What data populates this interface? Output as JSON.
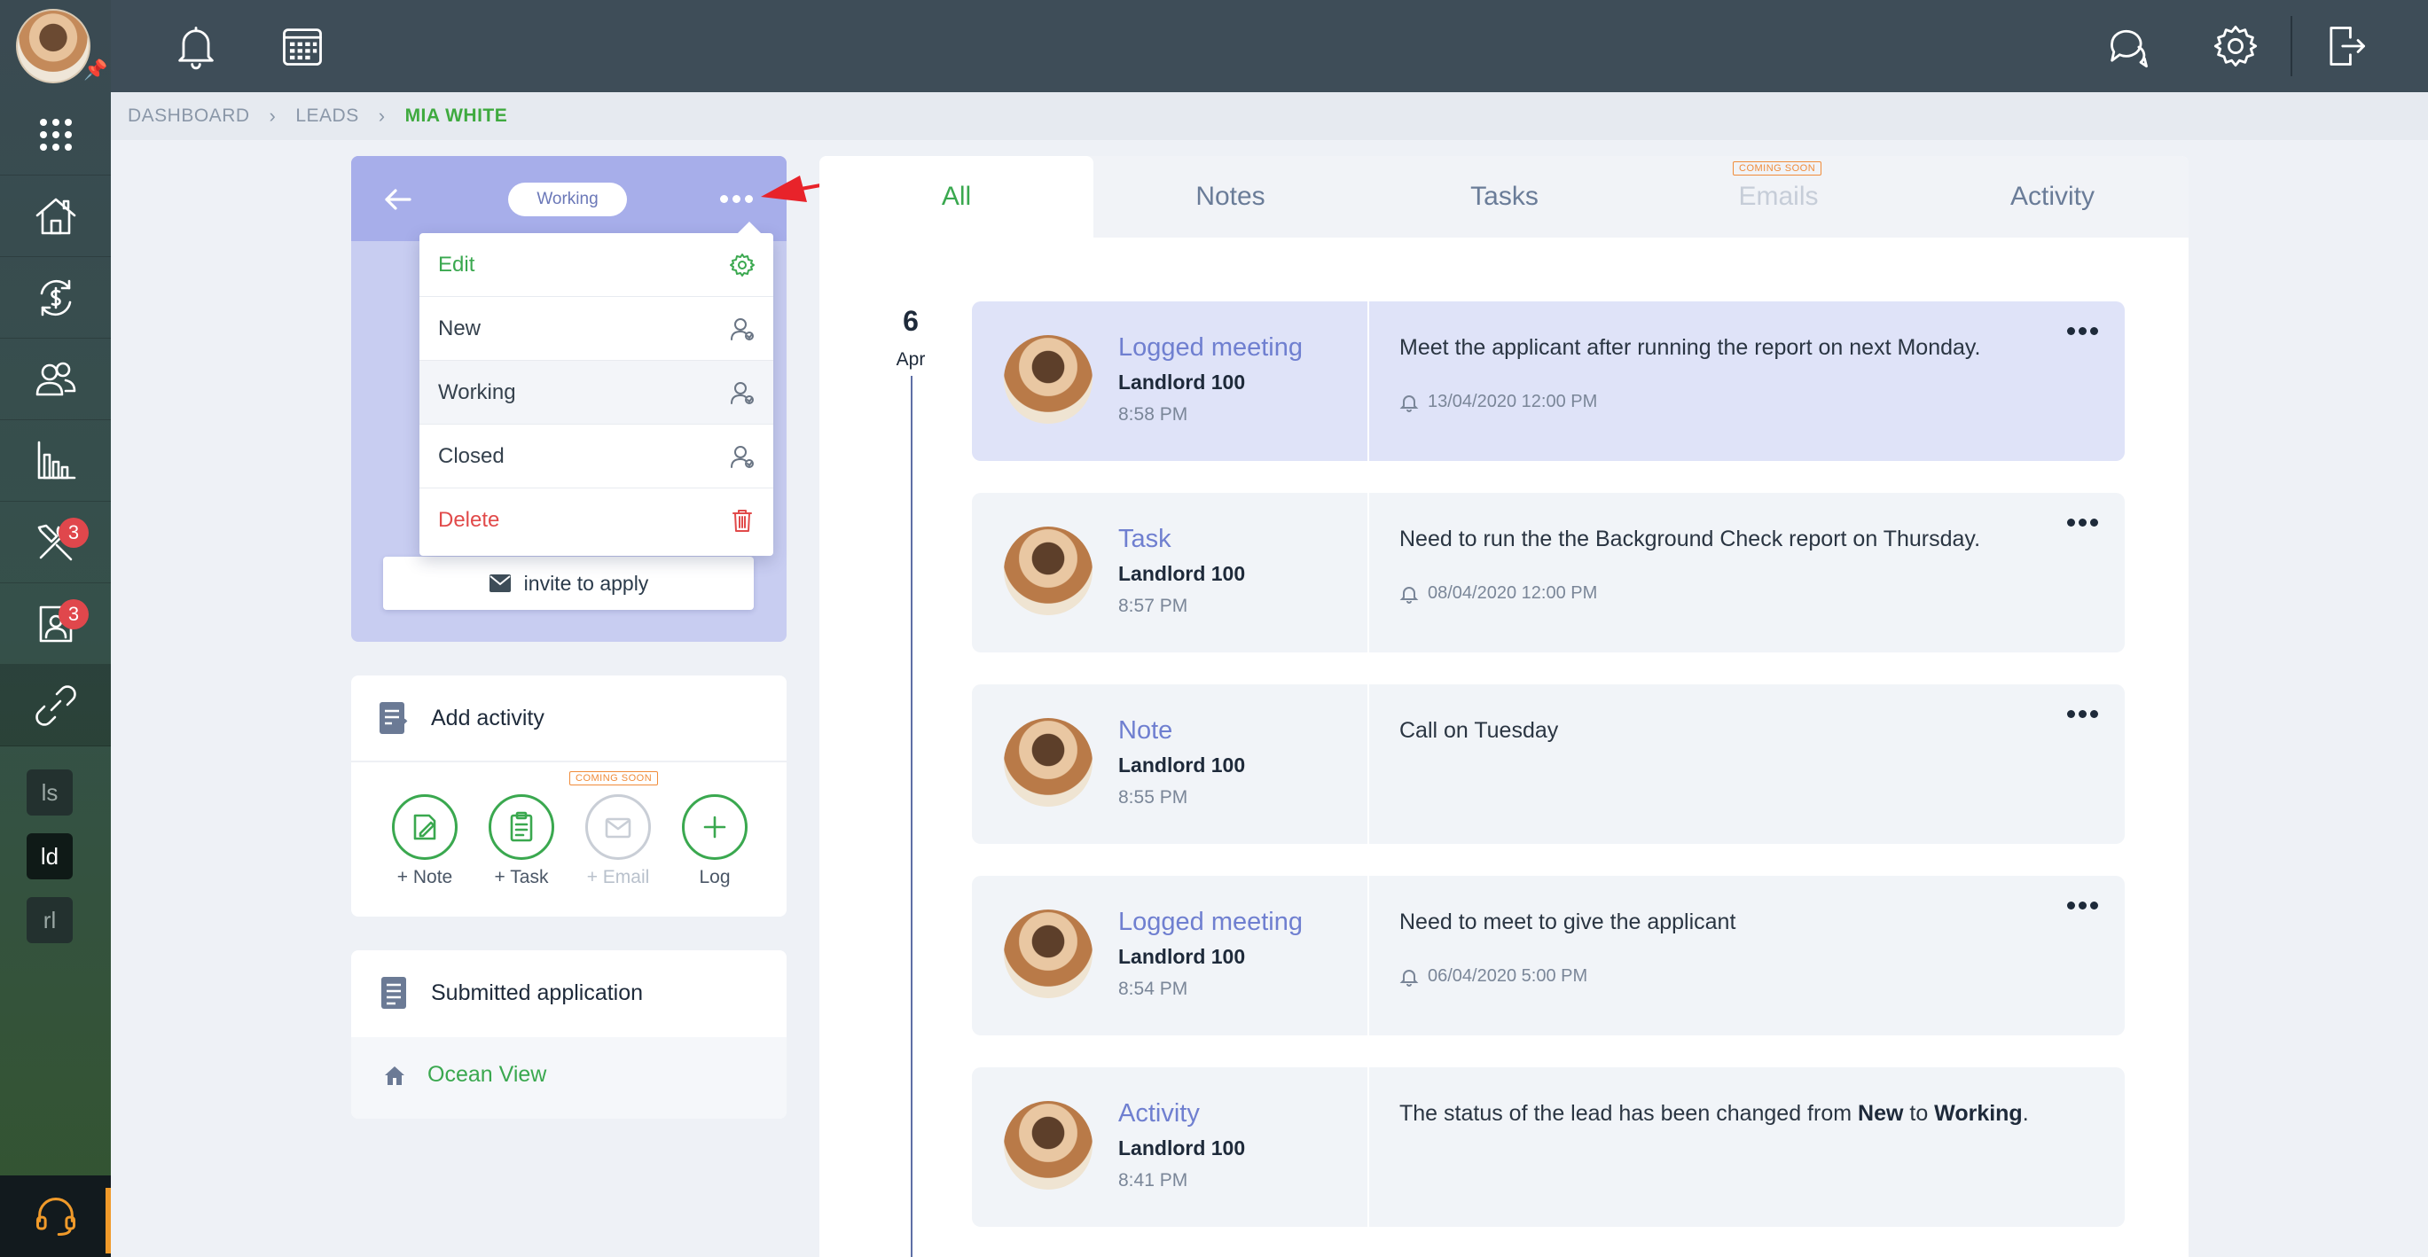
{
  "breadcrumb": {
    "items": [
      "DASHBOARD",
      "LEADS",
      "MIA WHITE"
    ]
  },
  "sidebar": {
    "badges": {
      "tools": "3",
      "applicants": "3"
    },
    "chips": [
      "ls",
      "ld",
      "rl"
    ]
  },
  "lead": {
    "status": "Working",
    "invite_label": "invite to apply"
  },
  "dropdown": {
    "items": [
      "Edit",
      "New",
      "Working",
      "Closed",
      "Delete"
    ]
  },
  "add_activity": {
    "title": "Add activity",
    "coming_soon": "COMING SOON",
    "actions": [
      "+ Note",
      "+ Task",
      "+ Email",
      "Log"
    ]
  },
  "submitted": {
    "title": "Submitted application",
    "property": "Ocean View"
  },
  "tabs": {
    "items": [
      "All",
      "Notes",
      "Tasks",
      "Emails",
      "Activity"
    ],
    "active": "All",
    "coming_soon": "COMING SOON"
  },
  "timeline": {
    "day": "6",
    "month": "Apr",
    "entries": [
      {
        "type": "Logged meeting",
        "owner": "Landlord 100",
        "time": "8:58 PM",
        "text": "Meet the applicant after running the report on next Monday.",
        "reminder": "13/04/2020 12:00 PM"
      },
      {
        "type": "Task",
        "owner": "Landlord 100",
        "time": "8:57 PM",
        "text": "Need to run the the Background Check report on Thursday.",
        "reminder": "08/04/2020 12:00 PM"
      },
      {
        "type": "Note",
        "owner": "Landlord 100",
        "time": "8:55 PM",
        "text": "Call on Tuesday",
        "reminder": ""
      },
      {
        "type": "Logged meeting",
        "owner": "Landlord 100",
        "time": "8:54 PM",
        "text": "Need to meet to give the applicant",
        "reminder": "06/04/2020 5:00 PM"
      },
      {
        "type": "Activity",
        "owner": "Landlord 100",
        "time": "8:41 PM",
        "text_before": "The status of the lead has been changed from ",
        "text_from": "New",
        "text_mid": " to ",
        "text_to": "Working",
        "text_after": "."
      }
    ]
  },
  "colors": {
    "accent": "#3aa84f",
    "link": "#6f7fd0",
    "danger": "#e14a4a",
    "lead_header": "#a7aeea",
    "annotation_arrow": "#e8232a"
  },
  "icons": [
    "avatar",
    "pin-icon",
    "bell-icon",
    "calendar-icon",
    "chat-icon",
    "settings-icon",
    "logout-icon",
    "apps-icon",
    "house-icon",
    "money-cycle-icon",
    "people-icon",
    "chart-icon",
    "tools-icon",
    "applicant-icon",
    "link-icon",
    "support-headset-icon"
  ]
}
